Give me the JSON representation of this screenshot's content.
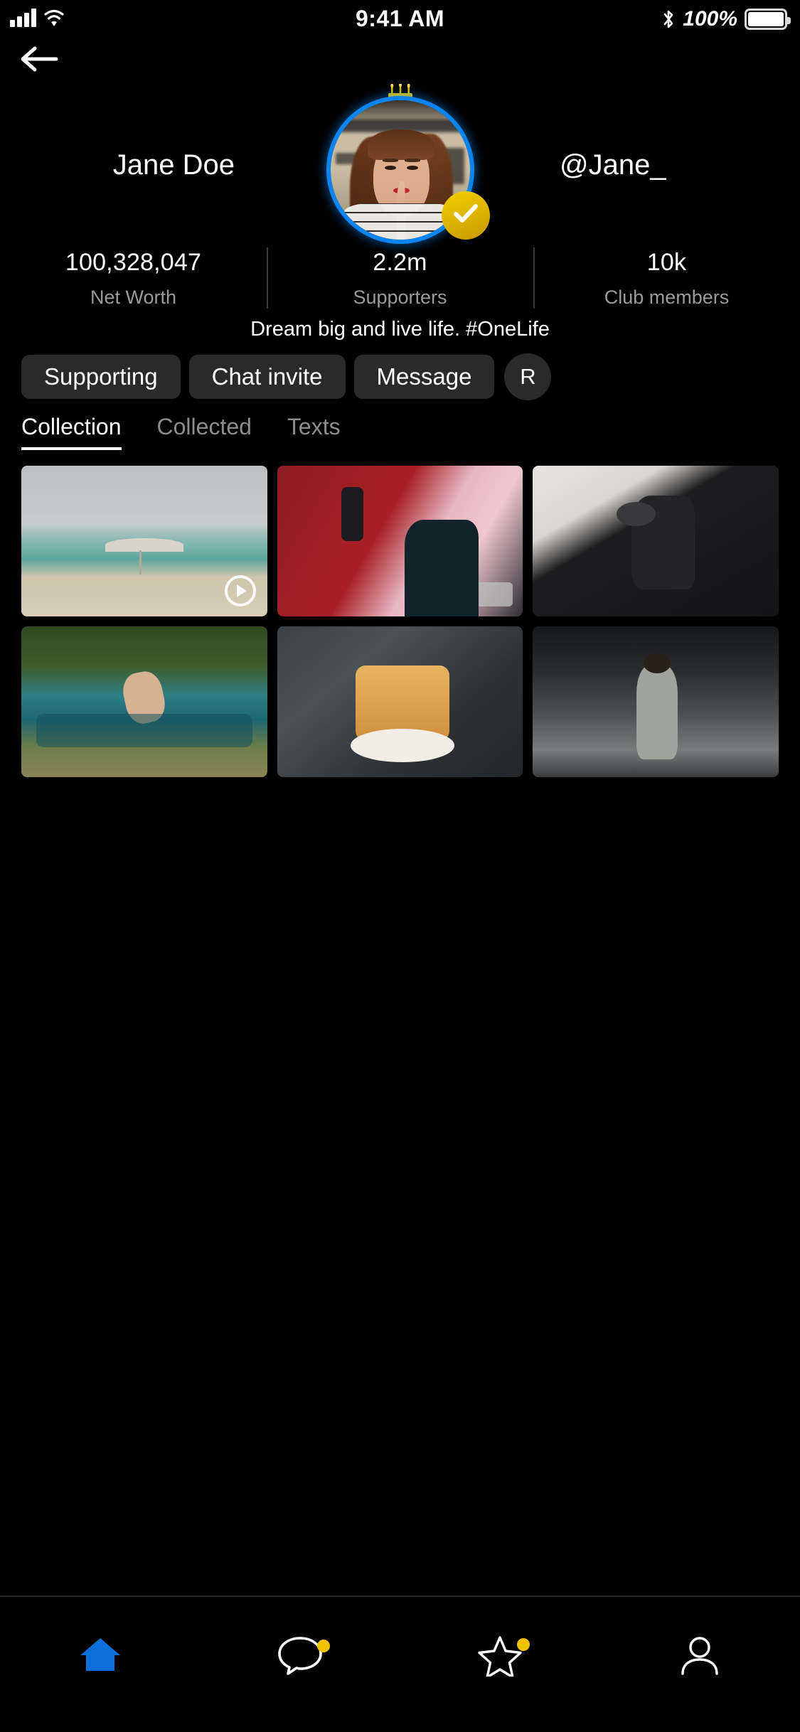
{
  "statusbar": {
    "time": "9:41 AM",
    "battery_pct": "100%",
    "icons": [
      "signal-icon",
      "wifi-icon",
      "bluetooth-icon",
      "battery-icon"
    ]
  },
  "nav": {
    "back_icon": "back-arrow-icon"
  },
  "profile": {
    "name": "Jane Doe",
    "username": "@Jane_",
    "bio": "Dream big and live life. #OneLife",
    "birthday_icon": "birthday-cake-icon",
    "verified_icon": "verified-check-icon",
    "avatar_ring_color": "#0a84f0",
    "verified_badge_color": "#e8bf00"
  },
  "stats": [
    {
      "value": "100,328,047",
      "label": "Net Worth"
    },
    {
      "value": "2.2m",
      "label": "Supporters"
    },
    {
      "value": "10k",
      "label": "Club members"
    }
  ],
  "actions": [
    {
      "label": "Supporting"
    },
    {
      "label": "Chat invite"
    },
    {
      "label": "Message"
    },
    {
      "label": "R"
    }
  ],
  "tabs": [
    {
      "label": "Collection",
      "active": true
    },
    {
      "label": "Collected",
      "active": false
    },
    {
      "label": "Texts",
      "active": false
    }
  ],
  "grid": [
    {
      "alt": "beach-umbrella-photo",
      "badge": "play-icon"
    },
    {
      "alt": "studio-microphone-photo",
      "badge": "video-icon"
    },
    {
      "alt": "boxing-woman-photo",
      "badge": ""
    },
    {
      "alt": "pool-jump-photo",
      "badge": ""
    },
    {
      "alt": "pancakes-berries-photo",
      "badge": ""
    },
    {
      "alt": "woman-street-fashion-photo",
      "badge": ""
    }
  ],
  "bottomnav": [
    {
      "icon": "home-icon",
      "active": true,
      "dot": false
    },
    {
      "icon": "chat-bubble-icon",
      "active": false,
      "dot": true
    },
    {
      "icon": "star-icon",
      "active": false,
      "dot": true
    },
    {
      "icon": "profile-person-icon",
      "active": false,
      "dot": false
    }
  ],
  "colors": {
    "accent_blue": "#0a84f0",
    "accent_yellow": "#f2c200",
    "bg": "#000000",
    "button_bg": "#2a2a2a",
    "muted_text": "#9b9b9b"
  }
}
